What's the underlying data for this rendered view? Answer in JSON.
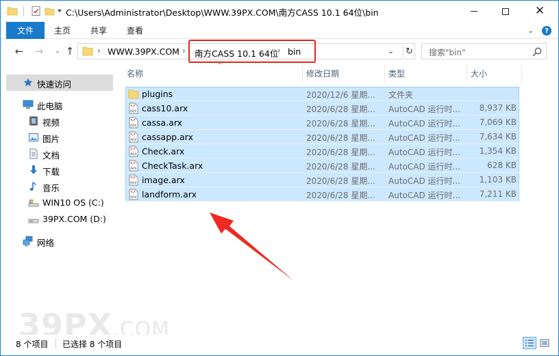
{
  "title": {
    "path": "C:\\Users\\Administrator\\Desktop\\WWW.39PX.COM\\南方CASS 10.1 64位\\bin"
  },
  "window_controls": {
    "minimize": "—",
    "maximize": "☐",
    "close": "✕"
  },
  "ribbon": {
    "tabs": [
      "文件",
      "主页",
      "共享",
      "查看"
    ],
    "expand": "⌄",
    "help": "?"
  },
  "address": {
    "crumbs": [
      "WWW.39PX.COM",
      "南方CASS 10.1 64位",
      "bin"
    ],
    "separator": "›",
    "dropdown": "⌄",
    "refresh": "↻"
  },
  "search": {
    "placeholder": "搜索\"bin\""
  },
  "nav_buttons": {
    "back": "←",
    "forward": "→",
    "recent": "⌄",
    "up": "↑"
  },
  "navpane": {
    "quick_access": "快速访问",
    "this_pc": "此电脑",
    "items": [
      "视频",
      "图片",
      "文档",
      "下载",
      "音乐",
      "WIN10 OS (C:)",
      "39PX.COM (D:)"
    ],
    "network": "网络"
  },
  "columns": {
    "name": "名称",
    "modified": "修改日期",
    "type": "类型",
    "size": "大小"
  },
  "files": [
    {
      "name": "plugins",
      "date": "2020/12/6 星期...",
      "type": "文件夹",
      "size": "",
      "icon": "folder-icon"
    },
    {
      "name": "cass10.arx",
      "date": "2020/6/28 星期...",
      "type": "AutoCAD 运行时...",
      "size": "8,937 KB",
      "icon": "arx-file-icon"
    },
    {
      "name": "cassa.arx",
      "date": "2020/6/28 星期...",
      "type": "AutoCAD 运行时...",
      "size": "7,069 KB",
      "icon": "arx-file-icon"
    },
    {
      "name": "cassapp.arx",
      "date": "2020/6/28 星期...",
      "type": "AutoCAD 运行时...",
      "size": "7,634 KB",
      "icon": "arx-file-icon"
    },
    {
      "name": "Check.arx",
      "date": "2020/6/28 星期...",
      "type": "AutoCAD 运行时...",
      "size": "1,354 KB",
      "icon": "arx-file-icon"
    },
    {
      "name": "CheckTask.arx",
      "date": "2020/6/28 星期...",
      "type": "AutoCAD 运行时...",
      "size": "628 KB",
      "icon": "arx-file-icon"
    },
    {
      "name": "image.arx",
      "date": "2020/6/28 星期...",
      "type": "AutoCAD 运行时...",
      "size": "1,103 KB",
      "icon": "arx-file-icon"
    },
    {
      "name": "landform.arx",
      "date": "2020/6/28 星期...",
      "type": "AutoCAD 运行时...",
      "size": "7,211 KB",
      "icon": "arx-file-icon"
    }
  ],
  "status": {
    "count": "8 个项目",
    "selected": "已选择 8 个项目"
  },
  "watermark": {
    "main": "39PX",
    "suffix": ".COM"
  },
  "colors": {
    "accent": "#1979ca",
    "selection": "#cce8ff",
    "selection_border": "#99d1ff",
    "annotation_red": "#e3241b"
  }
}
